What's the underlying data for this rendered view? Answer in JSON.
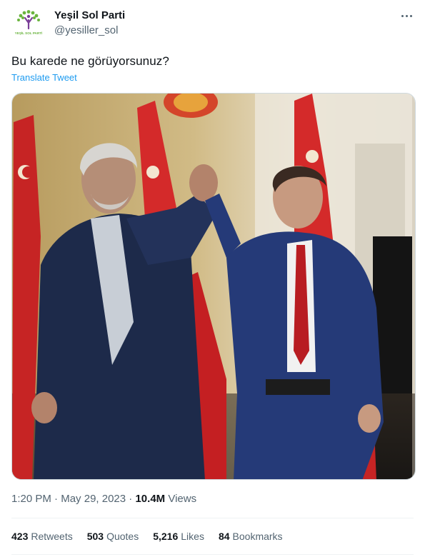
{
  "author": {
    "display_name": "Yeşil Sol Parti",
    "handle": "@yesiller_sol",
    "avatar_caption": "YEŞİL SOL PARTİ"
  },
  "tweet": {
    "text": "Bu karede ne görüyorsunuz?",
    "translate_label": "Translate Tweet",
    "time": "1:20 PM",
    "date": "May 29, 2023",
    "views_count": "10.4M",
    "views_label": "Views"
  },
  "stats": {
    "retweets": {
      "count": "423",
      "label": "Retweets"
    },
    "quotes": {
      "count": "503",
      "label": "Quotes"
    },
    "likes": {
      "count": "5,216",
      "label": "Likes"
    },
    "bookmarks": {
      "count": "84",
      "label": "Bookmarks"
    }
  },
  "colors": {
    "link": "#1d9bf0",
    "secondary_text": "#536471",
    "primary_text": "#0f1419",
    "flag_red": "#d42a2a",
    "logo_green": "#6ab43e",
    "logo_purple": "#7b3f99"
  }
}
